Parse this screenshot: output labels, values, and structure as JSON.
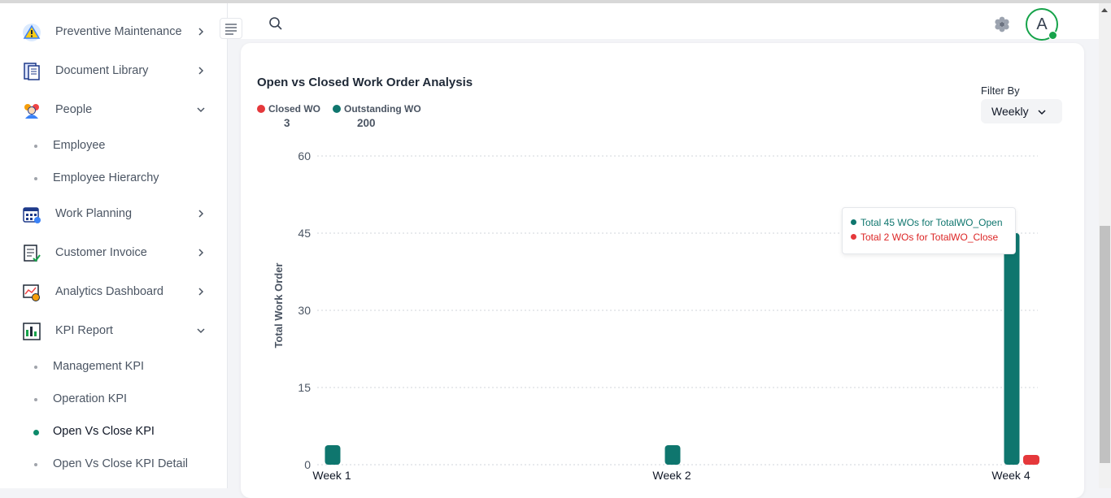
{
  "sidebar": {
    "items": [
      {
        "label": "Preventive Maintenance",
        "icon": "warning-triangle-icon",
        "expanded": false
      },
      {
        "label": "Document Library",
        "icon": "document-icon",
        "expanded": false
      },
      {
        "label": "People",
        "icon": "people-icon",
        "expanded": true
      },
      {
        "label": "Work Planning",
        "icon": "calendar-icon",
        "expanded": false
      },
      {
        "label": "Customer Invoice",
        "icon": "invoice-icon",
        "expanded": false
      },
      {
        "label": "Analytics Dashboard",
        "icon": "analytics-icon",
        "expanded": false
      },
      {
        "label": "KPI Report",
        "icon": "kpi-report-icon",
        "expanded": true
      }
    ],
    "people_sub": [
      {
        "label": "Employee"
      },
      {
        "label": "Employee Hierarchy"
      }
    ],
    "kpi_sub": [
      {
        "label": "Management KPI"
      },
      {
        "label": "Operation KPI"
      },
      {
        "label": "Open Vs Close KPI",
        "active": true
      },
      {
        "label": "Open Vs Close KPI Detail"
      }
    ]
  },
  "topbar": {
    "avatar_letter": "A"
  },
  "card": {
    "title": "Open vs Closed Work Order Analysis",
    "legend": [
      {
        "label": "Closed WO",
        "value": "3",
        "color": "#e5383b"
      },
      {
        "label": "Outstanding WO",
        "value": "200",
        "color": "#0f766e"
      }
    ],
    "filter_label": "Filter By",
    "filter_value": "Weekly"
  },
  "tooltip": {
    "open_line": "Total 45 WOs for TotalWO_Open",
    "close_line": "Total 2 WOs for TotalWO_Close"
  },
  "chart_data": {
    "type": "bar",
    "categories": [
      "Week 1",
      "Week 2",
      "Week 4"
    ],
    "series": [
      {
        "name": "TotalWO_Open",
        "values": [
          3,
          3,
          45
        ],
        "color": "#0f766e"
      },
      {
        "name": "TotalWO_Close",
        "values": [
          0,
          0,
          2
        ],
        "color": "#e5383b"
      }
    ],
    "ylabel": "Total Work Order",
    "yticks": [
      0,
      15,
      30,
      45,
      60
    ],
    "ylim": [
      0,
      60
    ],
    "grid": true
  }
}
